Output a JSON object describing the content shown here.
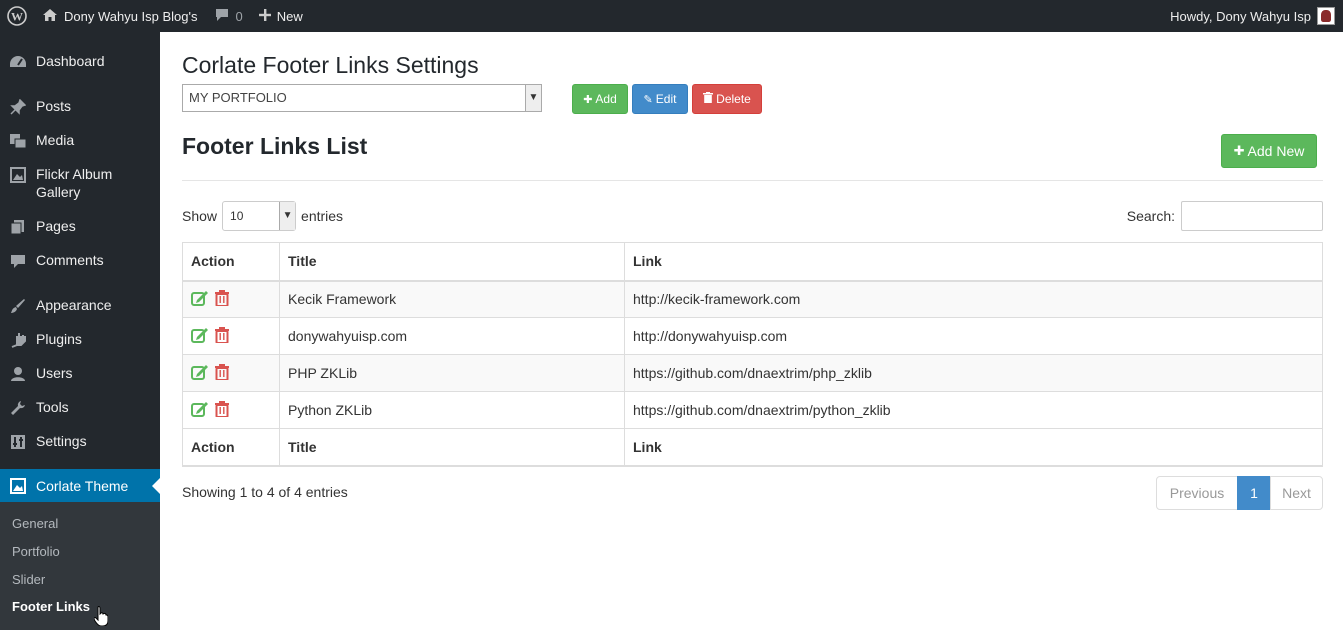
{
  "adminbar": {
    "site_name": "Dony Wahyu Isp Blog's",
    "comments_count": "0",
    "new_label": "New",
    "howdy": "Howdy, Dony Wahyu Isp"
  },
  "sidebar": {
    "items": [
      {
        "label": "Dashboard",
        "icon": "dashboard-icon"
      },
      {
        "label": "Posts",
        "icon": "pin-icon"
      },
      {
        "label": "Media",
        "icon": "media-icon"
      },
      {
        "label": "Flickr Album Gallery",
        "icon": "gallery-icon"
      },
      {
        "label": "Pages",
        "icon": "pages-icon"
      },
      {
        "label": "Comments",
        "icon": "comment-icon"
      },
      {
        "label": "Appearance",
        "icon": "brush-icon"
      },
      {
        "label": "Plugins",
        "icon": "plugin-icon"
      },
      {
        "label": "Users",
        "icon": "user-icon"
      },
      {
        "label": "Tools",
        "icon": "wrench-icon"
      },
      {
        "label": "Settings",
        "icon": "settings-icon"
      },
      {
        "label": "Corlate Theme",
        "icon": "theme-icon"
      }
    ],
    "submenu": [
      "General",
      "Portfolio",
      "Slider",
      "Footer Links"
    ]
  },
  "main": {
    "page_title": "Corlate Footer Links Settings",
    "group_select_value": "MY PORTFOLIO",
    "add_label": "Add",
    "edit_label": "Edit",
    "delete_label": "Delete",
    "list_title": "Footer Links List",
    "add_new_label": "Add New",
    "show_label": "Show",
    "length_value": "10",
    "entries_label": "entries",
    "search_label": "Search:",
    "search_value": "",
    "columns": [
      "Action",
      "Title",
      "Link"
    ],
    "rows": [
      {
        "title": "Kecik Framework",
        "link": "http://kecik-framework.com"
      },
      {
        "title": "donywahyuisp.com",
        "link": "http://donywahyuisp.com"
      },
      {
        "title": "PHP ZKLib",
        "link": "https://github.com/dnaextrim/php_zklib"
      },
      {
        "title": "Python ZKLib",
        "link": "https://github.com/dnaextrim/python_zklib"
      }
    ],
    "info": "Showing 1 to 4 of 4 entries",
    "pager": {
      "previous": "Previous",
      "page": "1",
      "next": "Next"
    }
  },
  "colors": {
    "adminbar_bg": "#23282d",
    "current_menu": "#0073aa",
    "success": "#5cb85c",
    "primary": "#428bca",
    "danger": "#d9534f"
  }
}
